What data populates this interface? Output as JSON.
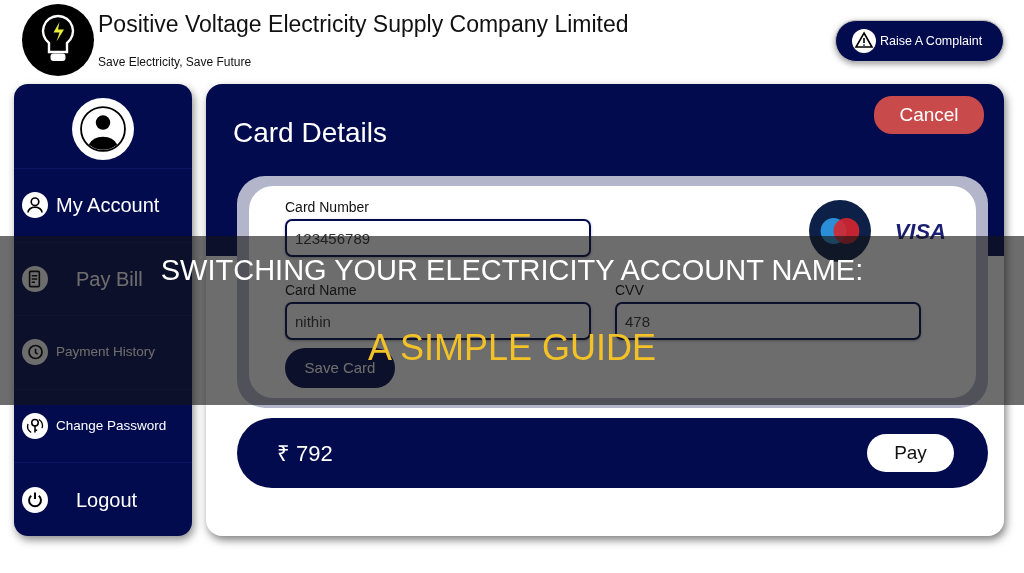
{
  "header": {
    "title": "Positive Voltage Electricity Supply Company Limited",
    "tagline": "Save Electricity, Save Future",
    "complaint_button": "Raise A Complaint"
  },
  "sidebar": {
    "items": [
      {
        "label": "My Account"
      },
      {
        "label": "Pay Bill"
      },
      {
        "label": "Payment History"
      },
      {
        "label": "Change Password"
      },
      {
        "label": "Logout"
      }
    ]
  },
  "panel": {
    "title": "Card Details",
    "cancel_button": "Cancel",
    "fields": [
      {
        "label": "Card Number",
        "value": "123456789"
      },
      {
        "label": "Card Name",
        "value": "nithin"
      },
      {
        "label": "CVV",
        "value": "478"
      }
    ],
    "save_button": "Save Card",
    "card_brand": "VISA",
    "amount": "₹ 792",
    "pay_button": "Pay"
  },
  "banner": {
    "line_1": "SWITCHING YOUR ELECTRICITY ACCOUNT NAME:",
    "line_2": "A SIMPLE GUIDE"
  }
}
